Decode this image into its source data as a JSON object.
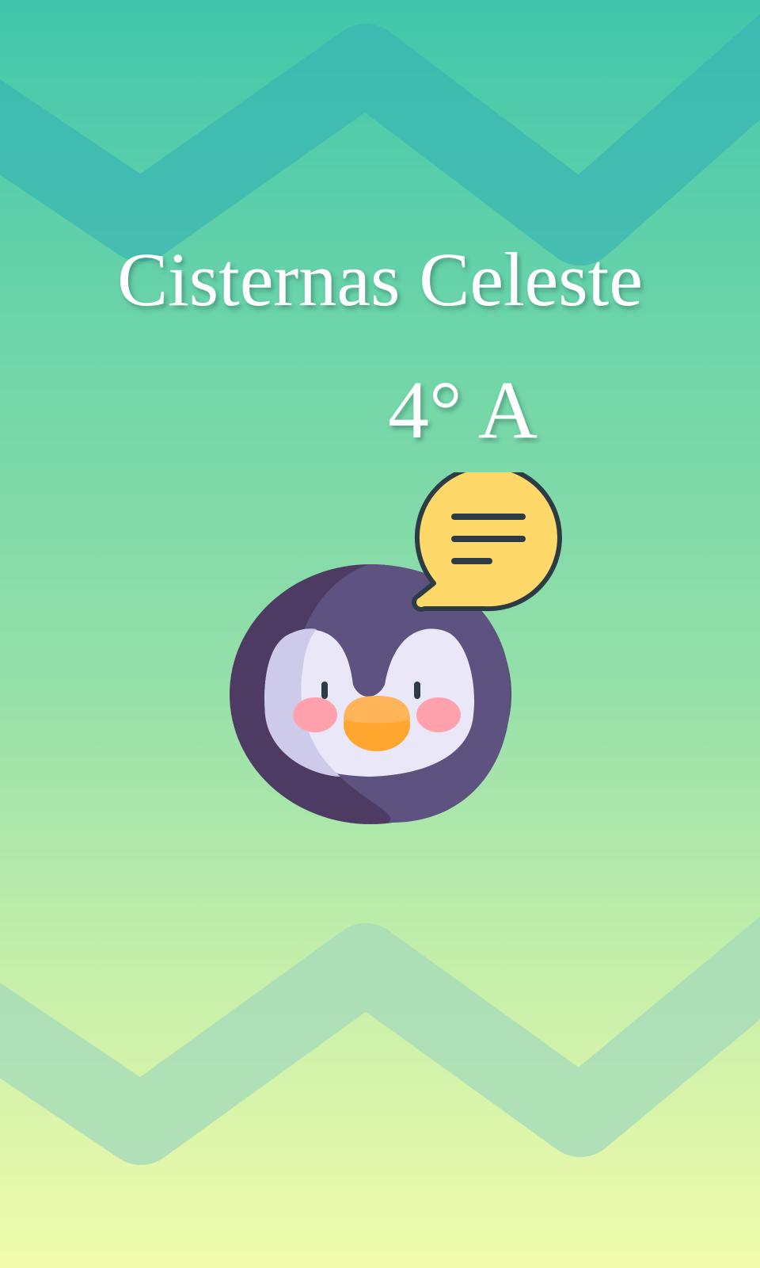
{
  "screen": {
    "title": "Cisternas Celeste",
    "grade": "4° A"
  },
  "icons": {
    "mascot": "penguin-icon",
    "bubble": "chat-bubble-icon"
  },
  "colors": {
    "background_top": "#41c6ab",
    "background_bottom": "#f1fbab",
    "zigzag_top": "#3ab5b3",
    "zigzag_bottom": "#a8dcb8",
    "title_text": "#ffffff",
    "penguin_body": "#5e5280",
    "penguin_shadow": "#4d3b64",
    "penguin_face": "#e9e7f8",
    "penguin_beak": "#ffa62f",
    "penguin_cheeks": "#ffa1ad",
    "bubble_fill": "#ffd86a",
    "bubble_outline": "#2d3b44"
  }
}
